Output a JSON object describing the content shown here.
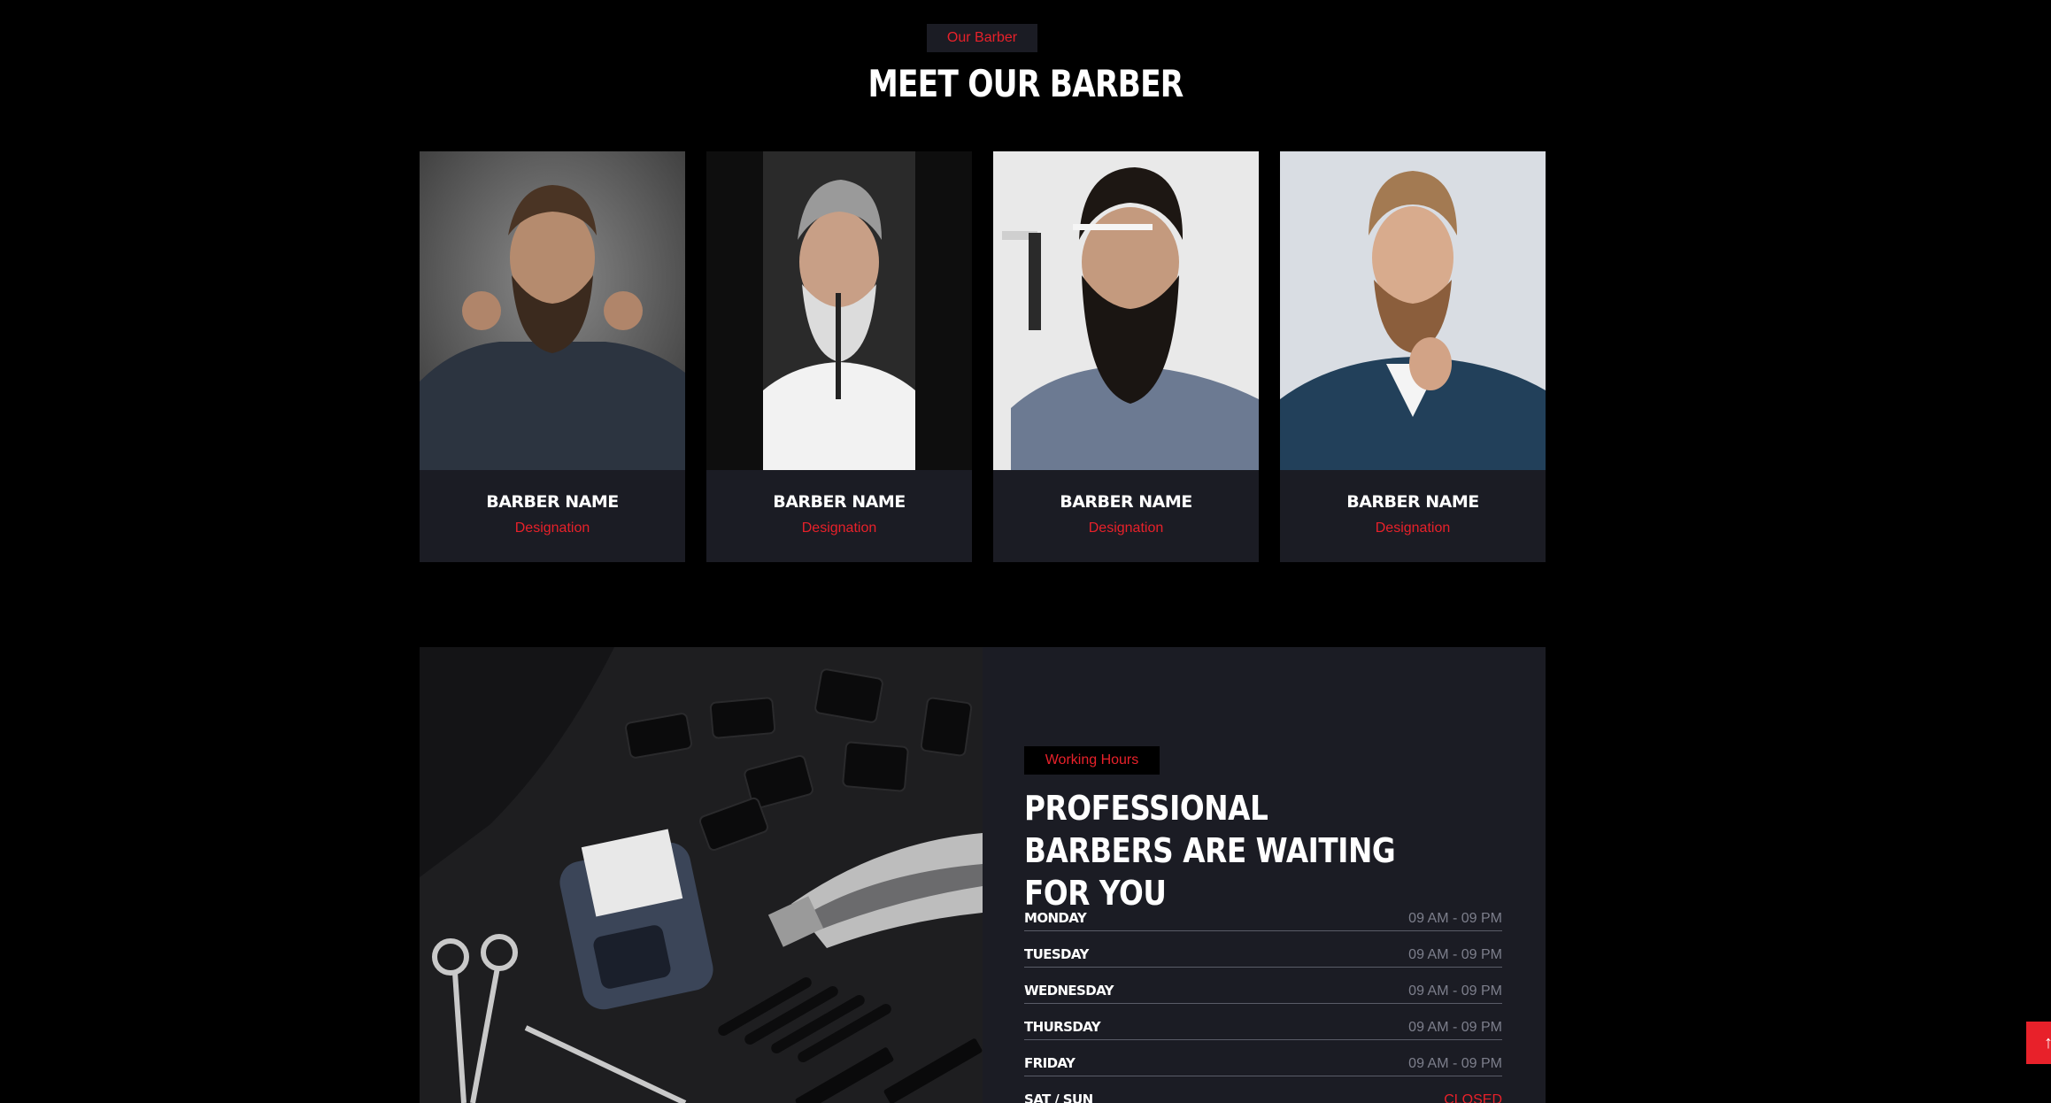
{
  "section": {
    "badge": "Our Barber",
    "title": "MEET OUR BARBER"
  },
  "barbers": [
    {
      "name": "BARBER NAME",
      "designation": "Designation"
    },
    {
      "name": "BARBER NAME",
      "designation": "Designation"
    },
    {
      "name": "BARBER NAME",
      "designation": "Designation"
    },
    {
      "name": "BARBER NAME",
      "designation": "Designation"
    }
  ],
  "working_hours": {
    "badge": "Working Hours",
    "title": "PROFESSIONAL BARBERS ARE WAITING FOR YOU",
    "rows": [
      {
        "day": "MONDAY",
        "time": "09 AM - 09 PM"
      },
      {
        "day": "TUESDAY",
        "time": "09 AM - 09 PM"
      },
      {
        "day": "WEDNESDAY",
        "time": "09 AM - 09 PM"
      },
      {
        "day": "THURSDAY",
        "time": "09 AM - 09 PM"
      },
      {
        "day": "FRIDAY",
        "time": "09 AM - 09 PM"
      },
      {
        "day": "SAT / SUN",
        "time": "CLOSED"
      }
    ]
  },
  "colors": {
    "accent": "#e8212a",
    "card_bg": "#1b1c24",
    "page_bg": "#000000",
    "muted_text": "#7d7f8c"
  },
  "icons": {
    "back_to_top": "arrow-up-icon"
  }
}
